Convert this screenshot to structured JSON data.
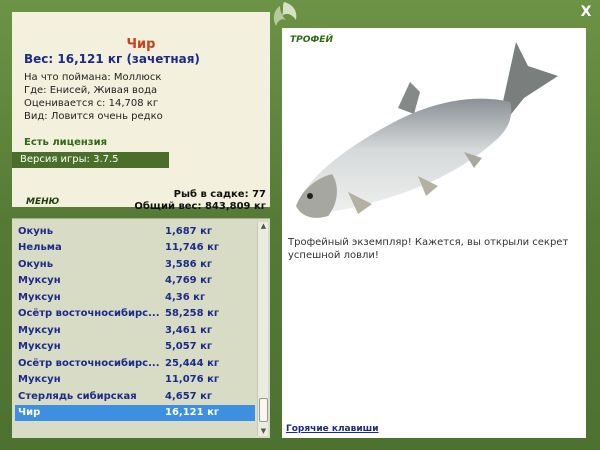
{
  "window": {
    "close_label": "X"
  },
  "fish": {
    "name": "Чир",
    "weight": "Вес: 16,121 кг (зачетная)",
    "bait": "На что поймана: Моллюск",
    "location": "Где: Енисей, Живая вода",
    "value": "Оценивается с: 14,708 кг",
    "kind": "Вид: Ловится очень редко"
  },
  "license": "Есть лицензия",
  "version": "Версия игры: 3.7.5",
  "menu_label": "МЕНЮ",
  "stats": {
    "fish_in_net": "Рыб в садке: 77",
    "total_weight": "Общий вес: 843,809 кг"
  },
  "catch_list": [
    {
      "name": "Окунь",
      "weight": "1,687 кг"
    },
    {
      "name": "Нельма",
      "weight": "11,746 кг"
    },
    {
      "name": "Окунь",
      "weight": "3,586 кг"
    },
    {
      "name": "Муксун",
      "weight": "4,769 кг"
    },
    {
      "name": "Муксун",
      "weight": "4,36 кг"
    },
    {
      "name": "Осётр восточносибирс...",
      "weight": "58,258 кг"
    },
    {
      "name": "Муксун",
      "weight": "3,461 кг"
    },
    {
      "name": "Муксун",
      "weight": "5,057 кг"
    },
    {
      "name": "Осётр восточносибирс...",
      "weight": "25,444 кг"
    },
    {
      "name": "Муксун",
      "weight": "11,076 кг"
    },
    {
      "name": "Стерлядь сибирская",
      "weight": "4,657 кг"
    },
    {
      "name": "Чир",
      "weight": "16,121 кг",
      "selected": true
    }
  ],
  "trophy": {
    "title": "ТРОФЕЙ",
    "text": "Трофейный экземпляр! Кажется, вы открыли секрет успешной ловли!"
  },
  "hotkeys_label": "Горячие клавиши",
  "colors": {
    "frame": "#5a7f3a",
    "panel": "#f3f1dd",
    "selected_row": "#3d8fe1",
    "fish_name": "#c7431b",
    "list_text": "#1c2a8c"
  },
  "icons": {
    "logo": "leaf-logo-icon",
    "close": "close-icon",
    "fish": "whitefish-image"
  }
}
